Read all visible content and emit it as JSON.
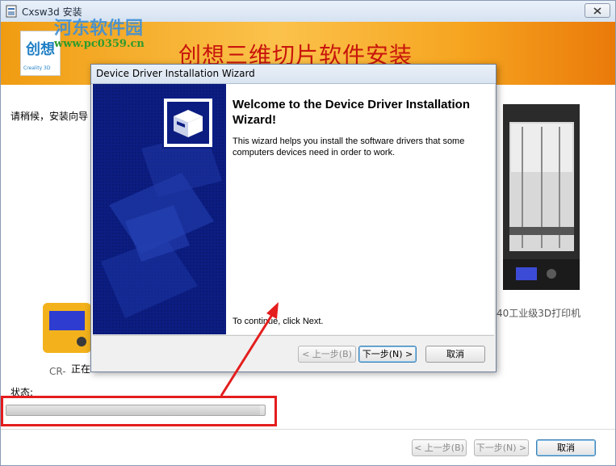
{
  "window": {
    "title": "Cxsw3d 安装",
    "close_icon": "close-icon"
  },
  "banner": {
    "logo_text": "创想",
    "logo_sub": "Creality 3D",
    "watermark_title": "河东软件园",
    "watermark_url": "www.pc0359.cn",
    "title": "创想三维切片软件安装"
  },
  "installer": {
    "wait_text": "请稍候，安装向导",
    "doing_text": "正在",
    "printer_right_caption": "40工业级3D打印机",
    "printer_left_caption": "CR-",
    "status_label": "状态:",
    "progress_value": 0.98,
    "back_button": "< 上一步(B)",
    "next_button": "下一步(N) >",
    "cancel_button": "取消"
  },
  "dialog": {
    "title": "Device Driver Installation Wizard",
    "heading": "Welcome to the Device Driver Installation Wizard!",
    "body": "This wizard helps you install the software drivers that some computers devices need in order to work.",
    "continue_text": "To continue, click Next.",
    "back_button": "< 上一步(B)",
    "next_button": "下一步(N) >",
    "cancel_button": "取消"
  },
  "colors": {
    "annotation_red": "#e41d1d",
    "wizard_blue": "#0c1d82",
    "banner_orange": "#f6a520",
    "banner_text_red": "#c8150c"
  }
}
